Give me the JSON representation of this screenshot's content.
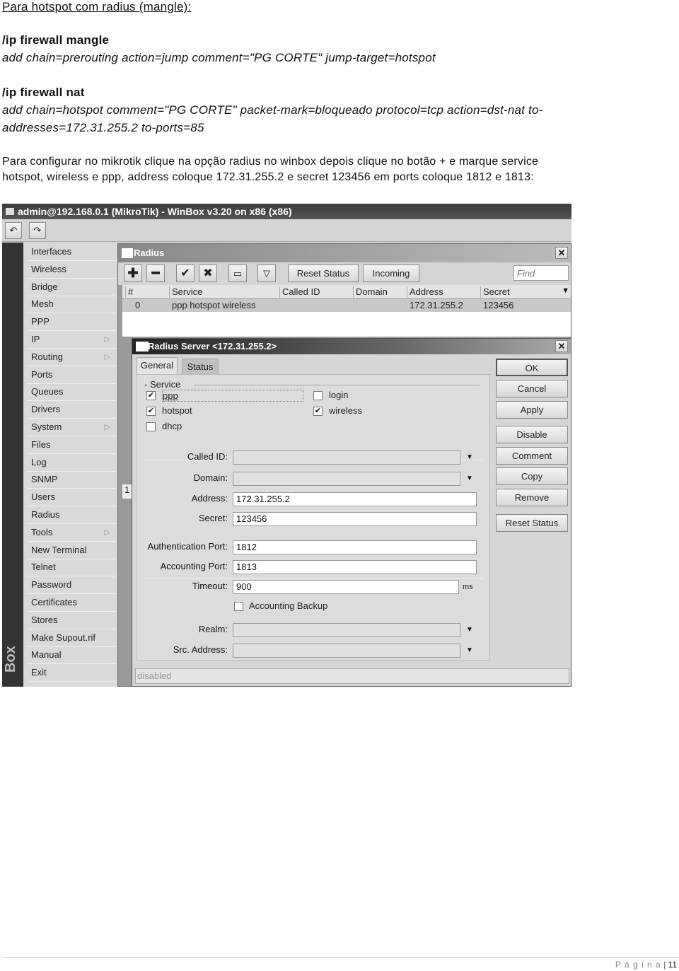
{
  "doc": {
    "heading": "Para hotspot com radius (mangle):",
    "mangle_title": "/ip firewall mangle",
    "mangle_cmd": "add chain=prerouting action=jump comment=\"PG CORTE\" jump-target=hotspot",
    "nat_title": "/ip firewall nat",
    "nat_cmd_1": "add chain=hotspot comment=\"PG CORTE\" packet-mark=bloqueado protocol=tcp action=dst-nat to-",
    "nat_cmd_2": "addresses=172.31.255.2 to-ports=85",
    "para_1": "Para configurar no mikrotik clique na opção radius no winbox depois clique no botão + e marque service",
    "para_2": "hotspot, wireless e ppp, address coloque 172.31.255.2 e secret 123456 em ports coloque 1812 e 1813:",
    "footer_page_label": "P á g i n a",
    "footer_page_number": "11"
  },
  "winbox": {
    "title": "admin@192.168.0.1 (MikroTik) - WinBox v3.20 on x86 (x86)",
    "brand_vertical": "Box",
    "sidebar": [
      {
        "label": "Interfaces"
      },
      {
        "label": "Wireless"
      },
      {
        "label": "Bridge"
      },
      {
        "label": "Mesh"
      },
      {
        "label": "PPP"
      },
      {
        "label": "IP",
        "submenu": true
      },
      {
        "label": "Routing",
        "submenu": true
      },
      {
        "label": "Ports"
      },
      {
        "label": "Queues"
      },
      {
        "label": "Drivers"
      },
      {
        "label": "System",
        "submenu": true
      },
      {
        "label": "Files"
      },
      {
        "label": "Log"
      },
      {
        "label": "SNMP"
      },
      {
        "label": "Users"
      },
      {
        "label": "Radius"
      },
      {
        "label": "Tools",
        "submenu": true
      },
      {
        "label": "New Terminal"
      },
      {
        "label": "Telnet"
      },
      {
        "label": "Password"
      },
      {
        "label": "Certificates"
      },
      {
        "label": "Stores"
      },
      {
        "label": "Make Supout.rif"
      },
      {
        "label": "Manual"
      },
      {
        "label": "Exit"
      }
    ],
    "radius": {
      "title": "Radius",
      "reset_status": "Reset Status",
      "incoming": "Incoming",
      "find_placeholder": "Find",
      "columns": [
        "#",
        "Service",
        "Called ID",
        "Domain",
        "Address",
        "Secret"
      ],
      "rows": [
        {
          "num": "0",
          "service": "ppp hotspot wireless",
          "called_id": "",
          "domain": "",
          "address": "172.31.255.2",
          "secret": "123456"
        }
      ],
      "row_count_indicator": "1"
    },
    "server": {
      "title": "Radius Server <172.31.255.2>",
      "tabs": [
        "General",
        "Status"
      ],
      "service_group": "Service",
      "services": {
        "ppp": {
          "label": "ppp",
          "checked": true
        },
        "login": {
          "label": "login",
          "checked": false
        },
        "hotspot": {
          "label": "hotspot",
          "checked": true
        },
        "wireless": {
          "label": "wireless",
          "checked": true
        },
        "dhcp": {
          "label": "dhcp",
          "checked": false
        }
      },
      "labels": {
        "called_id": "Called ID:",
        "domain": "Domain:",
        "address": "Address:",
        "secret": "Secret:",
        "auth_port": "Authentication Port:",
        "acct_port": "Accounting Port:",
        "timeout": "Timeout:",
        "realm": "Realm:",
        "src_address": "Src. Address:"
      },
      "values": {
        "called_id": "",
        "domain": "",
        "address": "172.31.255.2",
        "secret": "123456",
        "auth_port": "1812",
        "acct_port": "1813",
        "timeout": "900",
        "realm": "",
        "src_address": ""
      },
      "timeout_unit": "ms",
      "accounting_backup": {
        "label": "Accounting Backup",
        "checked": false
      },
      "buttons": [
        "OK",
        "Cancel",
        "Apply",
        "Disable",
        "Comment",
        "Copy",
        "Remove",
        "Reset Status"
      ],
      "status": "disabled"
    }
  }
}
